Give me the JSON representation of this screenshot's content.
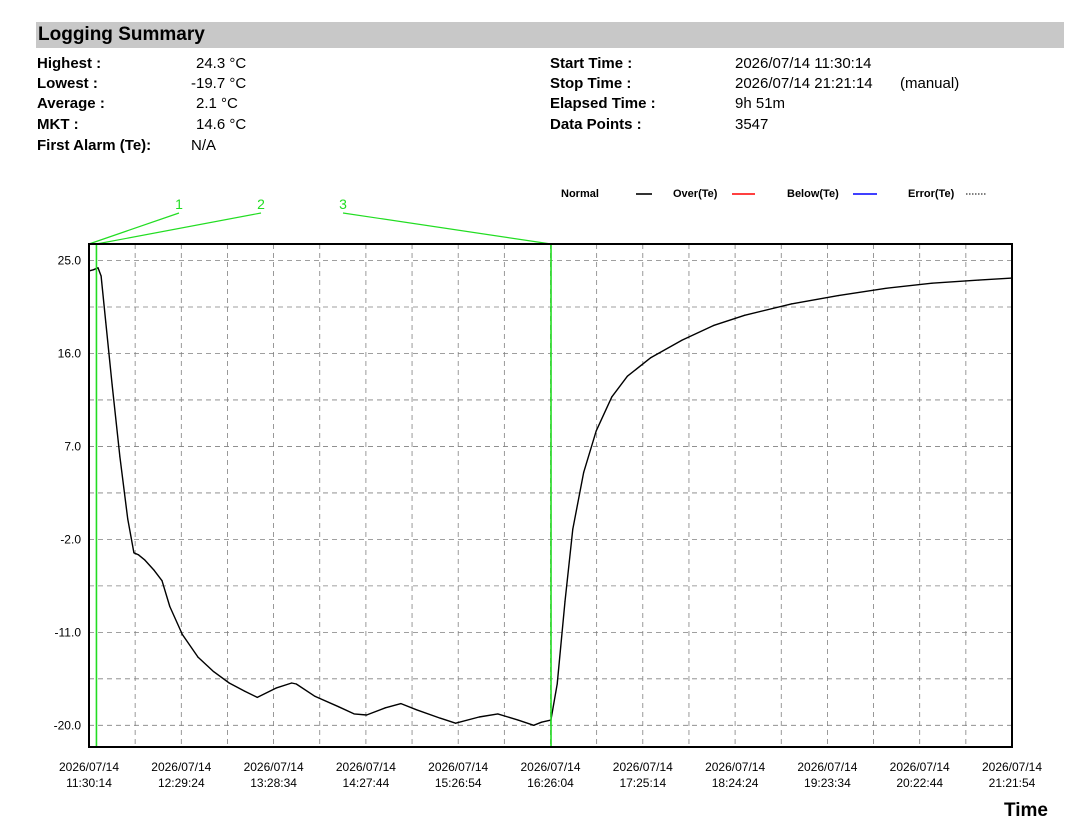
{
  "summary": {
    "title": "Logging Summary",
    "left": [
      {
        "label": "Highest :",
        "value": "24.3 °C"
      },
      {
        "label": "Lowest :",
        "value": "-19.7 °C"
      },
      {
        "label": "Average :",
        "value": "2.1 °C"
      },
      {
        "label": "MKT :",
        "value": "14.6 °C"
      },
      {
        "label": "First Alarm (Te):",
        "value": "N/A"
      }
    ],
    "right": [
      {
        "label": "Start Time :",
        "value": "2026/07/14 11:30:14"
      },
      {
        "label": "Stop Time :",
        "value": "2026/07/14 21:21:14",
        "note": "(manual)"
      },
      {
        "label": "Elapsed Time :",
        "value": "9h 51m"
      },
      {
        "label": "Data Points :",
        "value": "3547"
      }
    ]
  },
  "legend": {
    "items": [
      {
        "label": "Normal",
        "color": "#000000",
        "style": "solid"
      },
      {
        "label": "Over(Te)",
        "color": "#ff0000",
        "style": "solid"
      },
      {
        "label": "Below(Te)",
        "color": "#0000ff",
        "style": "solid"
      },
      {
        "label": "Error(Te)",
        "color": "#808080",
        "style": "dotted"
      }
    ]
  },
  "markers": [
    {
      "label": "1",
      "time": "2026/07/14 11:30:14"
    },
    {
      "label": "2",
      "time": "2026/07/14 11:35:00"
    },
    {
      "label": "3",
      "time": "2026/07/14 16:26:04"
    }
  ],
  "colors": {
    "marker": "#22dd22",
    "grid": "#808080",
    "series": "#000000"
  },
  "xaxis_title": "Time",
  "chart_data": {
    "type": "line",
    "xlabel": "Time",
    "ylabel": "",
    "ylim": [
      -22.1,
      26.6
    ],
    "xlim": [
      "2026/07/14 11:30:14",
      "2026/07/14 21:21:14"
    ],
    "yticks": [
      "25.0",
      "16.0",
      "7.0",
      "-2.0",
      "-11.0",
      "-20.0"
    ],
    "xticks": [
      {
        "date": "2026/07/14",
        "time": "11:30:14"
      },
      {
        "date": "2026/07/14",
        "time": "12:29:24"
      },
      {
        "date": "2026/07/14",
        "time": "13:28:34"
      },
      {
        "date": "2026/07/14",
        "time": "14:27:44"
      },
      {
        "date": "2026/07/14",
        "time": "15:26:54"
      },
      {
        "date": "2026/07/14",
        "time": "16:26:04"
      },
      {
        "date": "2026/07/14",
        "time": "17:25:14"
      },
      {
        "date": "2026/07/14",
        "time": "18:24:24"
      },
      {
        "date": "2026/07/14",
        "time": "19:23:34"
      },
      {
        "date": "2026/07/14",
        "time": "20:22:44"
      },
      {
        "date": "2026/07/14",
        "time": "21:21:54"
      }
    ],
    "grid": true,
    "series": [
      {
        "color": "#000000",
        "points": [
          [
            "2026/07/14 11:30:14",
            24.0
          ],
          [
            "2026/07/14 11:33:00",
            24.1
          ],
          [
            "2026/07/14 11:36:00",
            24.3
          ],
          [
            "2026/07/14 11:38:00",
            23.5
          ],
          [
            "2026/07/14 11:41:00",
            19.0
          ],
          [
            "2026/07/14 11:45:00",
            13.0
          ],
          [
            "2026/07/14 11:50:00",
            6.0
          ],
          [
            "2026/07/14 11:55:00",
            0.0
          ],
          [
            "2026/07/14 11:59:00",
            -3.3
          ],
          [
            "2026/07/14 12:02:00",
            -3.5
          ],
          [
            "2026/07/14 12:06:00",
            -4.0
          ],
          [
            "2026/07/14 12:12:00",
            -5.0
          ],
          [
            "2026/07/14 12:17:00",
            -6.0
          ],
          [
            "2026/07/14 12:22:00",
            -8.5
          ],
          [
            "2026/07/14 12:30:00",
            -11.2
          ],
          [
            "2026/07/14 12:40:00",
            -13.4
          ],
          [
            "2026/07/14 12:50:00",
            -14.8
          ],
          [
            "2026/07/14 13:00:00",
            -15.9
          ],
          [
            "2026/07/14 13:10:00",
            -16.7
          ],
          [
            "2026/07/14 13:18:00",
            -17.3
          ],
          [
            "2026/07/14 13:30:00",
            -16.4
          ],
          [
            "2026/07/14 13:40:00",
            -15.9
          ],
          [
            "2026/07/14 13:43:00",
            -16.0
          ],
          [
            "2026/07/14 13:55:00",
            -17.2
          ],
          [
            "2026/07/14 14:10:00",
            -18.2
          ],
          [
            "2026/07/14 14:20:00",
            -18.9
          ],
          [
            "2026/07/14 14:28:00",
            -19.0
          ],
          [
            "2026/07/14 14:40:00",
            -18.3
          ],
          [
            "2026/07/14 14:50:00",
            -17.9
          ],
          [
            "2026/07/14 15:00:00",
            -18.5
          ],
          [
            "2026/07/14 15:15:00",
            -19.3
          ],
          [
            "2026/07/14 15:25:00",
            -19.8
          ],
          [
            "2026/07/14 15:40:00",
            -19.2
          ],
          [
            "2026/07/14 15:52:00",
            -18.9
          ],
          [
            "2026/07/14 16:05:00",
            -19.5
          ],
          [
            "2026/07/14 16:15:00",
            -20.0
          ],
          [
            "2026/07/14 16:20:00",
            -19.7
          ],
          [
            "2026/07/14 16:26:00",
            -19.5
          ],
          [
            "2026/07/14 16:30:00",
            -16.0
          ],
          [
            "2026/07/14 16:35:00",
            -8.0
          ],
          [
            "2026/07/14 16:40:00",
            -1.0
          ],
          [
            "2026/07/14 16:47:00",
            4.5
          ],
          [
            "2026/07/14 16:55:00",
            8.5
          ],
          [
            "2026/07/14 17:05:00",
            11.8
          ],
          [
            "2026/07/14 17:15:00",
            13.8
          ],
          [
            "2026/07/14 17:30:00",
            15.6
          ],
          [
            "2026/07/14 17:50:00",
            17.3
          ],
          [
            "2026/07/14 18:10:00",
            18.7
          ],
          [
            "2026/07/14 18:30:00",
            19.7
          ],
          [
            "2026/07/14 19:00:00",
            20.8
          ],
          [
            "2026/07/14 19:30:00",
            21.6
          ],
          [
            "2026/07/14 20:00:00",
            22.3
          ],
          [
            "2026/07/14 20:30:00",
            22.8
          ],
          [
            "2026/07/14 21:00:00",
            23.1
          ],
          [
            "2026/07/14 21:21:14",
            23.3
          ]
        ]
      }
    ]
  }
}
